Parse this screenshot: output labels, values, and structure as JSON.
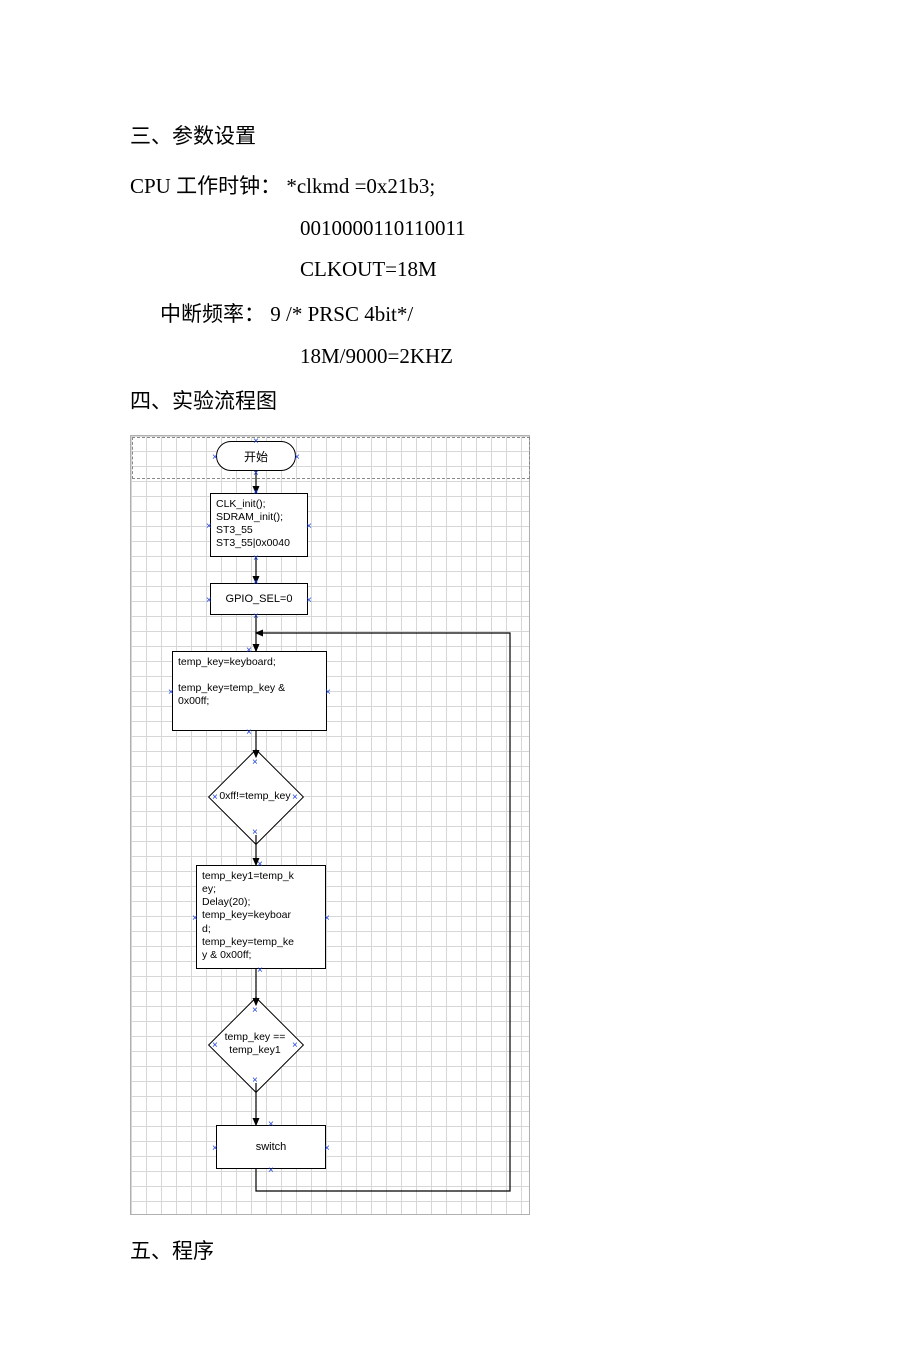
{
  "section3_title": "三、参数设置",
  "cpu_clock_label": "CPU 工作时钟：  *clkmd =0x21b3;",
  "cpu_clock_bits": "0010000110110011",
  "cpu_clock_out": "CLKOUT=18M",
  "interrupt_label": "中断频率：      9       /* PRSC 4bit*/",
  "interrupt_calc": "18M/9000=2KHZ",
  "section4_title": "四、实验流程图",
  "flow": {
    "start": "开始",
    "init_block": "CLK_init();\nSDRAM_init();\nST3_55\nST3_55|0x0040",
    "gpio": "GPIO_SEL=0",
    "readkey": "temp_key=keyboard;\n\ntemp_key=temp_key &\n0x00ff;",
    "dec1": "0xff!=temp_key",
    "process2": "temp_key1=temp_k\ney;\nDelay(20);\ntemp_key=keyboar\nd;\ntemp_key=temp_ke\ny & 0x00ff;",
    "dec2": "temp_key ==\ntemp_key1",
    "switch": "switch"
  },
  "section5_title": "五、程序"
}
